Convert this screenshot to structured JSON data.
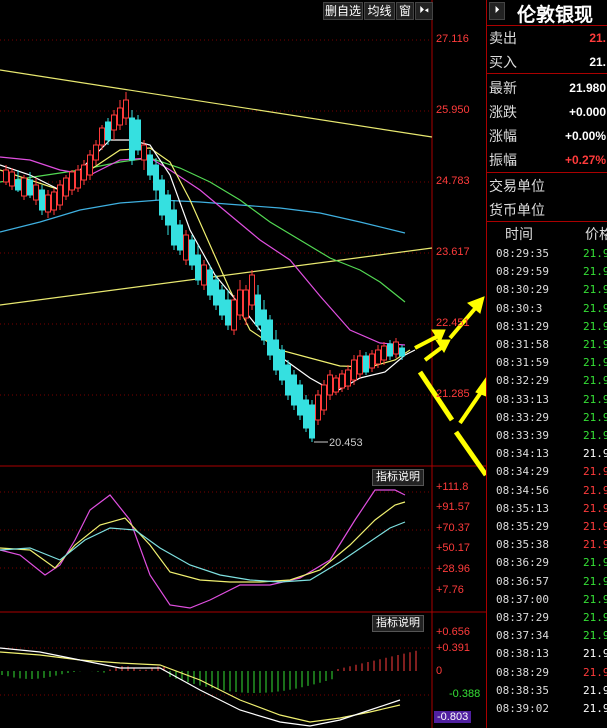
{
  "toolbar": {
    "btn1": "删自选",
    "btn2": "均线",
    "btn3": "窗",
    "btn4": "⏵◂"
  },
  "price_axis": [
    "27.116",
    "25.950",
    "24.783",
    "23.617",
    "22.451",
    "21.285"
  ],
  "low_label": "20.453",
  "ind1": {
    "button": "指标说明",
    "ticks": [
      "+111.8",
      "+91.57",
      "+70.37",
      "+50.17",
      "+28.96",
      "+7.76"
    ]
  },
  "ind2": {
    "button": "指标说明",
    "ticks": [
      "+0.656",
      "+0.391",
      "0",
      "-0.388",
      "-0.803"
    ]
  },
  "right_panel": {
    "title": "伦敦银现",
    "rows": [
      {
        "k": "卖出",
        "v": "21.",
        "c": "#ff3b3b"
      },
      {
        "k": "买入",
        "v": "21.",
        "c": "#ffffff"
      },
      {
        "k": "最新",
        "v": "21.980",
        "c": "#ffffff"
      },
      {
        "k": "涨跌",
        "v": "+0.000",
        "c": "#ffffff"
      },
      {
        "k": "涨幅",
        "v": "+0.00%",
        "c": "#ffffff"
      },
      {
        "k": "振幅",
        "v": "+0.27%",
        "c": "#ff3b3b"
      },
      {
        "k": "交易单位",
        "v": "",
        "c": "#ffffff"
      },
      {
        "k": "货币单位",
        "v": "",
        "c": "#ffffff"
      }
    ],
    "header_time": "时间",
    "header_price": "价格",
    "trades": [
      {
        "t": "08:29:35",
        "p": "21.9",
        "c": "#35e035"
      },
      {
        "t": "08:29:59",
        "p": "21.9",
        "c": "#35e035"
      },
      {
        "t": "08:30:29",
        "p": "21.9",
        "c": "#35e035"
      },
      {
        "t": "08:30:3",
        "p": "21.9",
        "c": "#35e035"
      },
      {
        "t": "08:31:29",
        "p": "21.9",
        "c": "#35e035"
      },
      {
        "t": "08:31:58",
        "p": "21.9",
        "c": "#35e035"
      },
      {
        "t": "08:31:59",
        "p": "21.9",
        "c": "#35e035"
      },
      {
        "t": "08:32:29",
        "p": "21.9",
        "c": "#35e035"
      },
      {
        "t": "08:33:13",
        "p": "21.9",
        "c": "#35e035"
      },
      {
        "t": "08:33:29",
        "p": "21.9",
        "c": "#35e035"
      },
      {
        "t": "08:33:39",
        "p": "21.9",
        "c": "#35e035"
      },
      {
        "t": "08:34:13",
        "p": "21.9",
        "c": "#ffffff"
      },
      {
        "t": "08:34:29",
        "p": "21.9",
        "c": "#ff3b3b"
      },
      {
        "t": "08:34:56",
        "p": "21.9",
        "c": "#ff3b3b"
      },
      {
        "t": "08:35:13",
        "p": "21.9",
        "c": "#ff3b3b"
      },
      {
        "t": "08:35:29",
        "p": "21.9",
        "c": "#ff3b3b"
      },
      {
        "t": "08:35:38",
        "p": "21.9",
        "c": "#ff3b3b"
      },
      {
        "t": "08:36:29",
        "p": "21.9",
        "c": "#35e035"
      },
      {
        "t": "08:36:57",
        "p": "21.9",
        "c": "#35e035"
      },
      {
        "t": "08:37:00",
        "p": "21.9",
        "c": "#35e035"
      },
      {
        "t": "08:37:29",
        "p": "21.9",
        "c": "#35e035"
      },
      {
        "t": "08:37:34",
        "p": "21.9",
        "c": "#35e035"
      },
      {
        "t": "08:38:13",
        "p": "21.9",
        "c": "#ffffff"
      },
      {
        "t": "08:38:29",
        "p": "21.9",
        "c": "#ff3b3b"
      },
      {
        "t": "08:38:35",
        "p": "21.9",
        "c": "#ffffff"
      },
      {
        "t": "08:39:02",
        "p": "21.9",
        "c": "#ffffff"
      }
    ]
  },
  "colors": {
    "up": "#ff3b3b",
    "down": "#35e0e0",
    "grid": "#7a0000",
    "arrow": "#ffff00"
  }
}
